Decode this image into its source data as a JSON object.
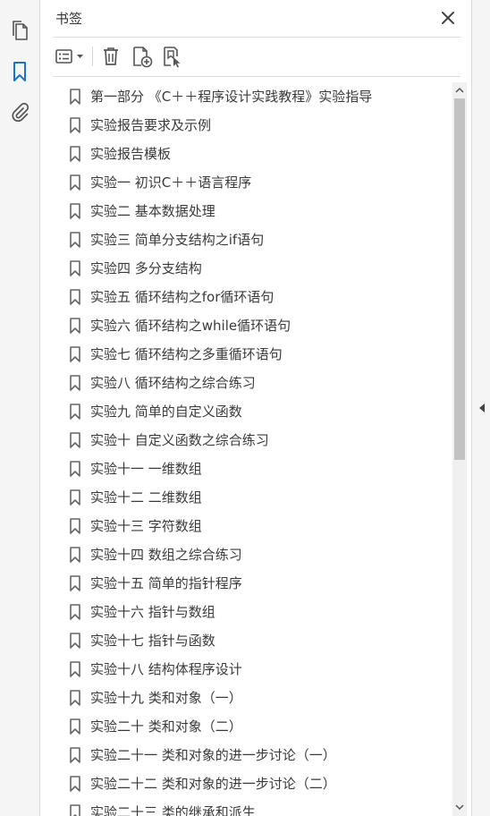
{
  "panel": {
    "title": "书签"
  },
  "rail": {
    "items": [
      {
        "icon": "pages-icon"
      },
      {
        "icon": "bookmark-icon",
        "active": true
      },
      {
        "icon": "paperclip-icon"
      }
    ]
  },
  "toolbar": {
    "items": [
      {
        "icon": "options-menu-icon"
      },
      {
        "icon": "trash-icon"
      },
      {
        "icon": "new-bookmark-icon"
      },
      {
        "icon": "bookmark-from-selection-icon"
      }
    ]
  },
  "colors": {
    "accent": "#1a73c9",
    "icon": "#555555",
    "text": "#3a3a3a",
    "scroll_thumb": "#c2c2c2"
  },
  "bookmarks": [
    {
      "label": "第一部分 《C＋＋程序设计实践教程》实验指导"
    },
    {
      "label": "实验报告要求及示例"
    },
    {
      "label": "实验报告模板"
    },
    {
      "label": "实验一  初识C＋＋语言程序"
    },
    {
      "label": "实验二  基本数据处理"
    },
    {
      "label": "实验三  简单分支结构之if语句"
    },
    {
      "label": "实验四  多分支结构"
    },
    {
      "label": "实验五  循环结构之for循环语句"
    },
    {
      "label": "实验六  循环结构之while循环语句"
    },
    {
      "label": "实验七  循环结构之多重循环语句"
    },
    {
      "label": "实验八  循环结构之综合练习"
    },
    {
      "label": "实验九  简单的自定义函数"
    },
    {
      "label": "实验十  自定义函数之综合练习"
    },
    {
      "label": "实验十一  一维数组"
    },
    {
      "label": "实验十二  二维数组"
    },
    {
      "label": "实验十三  字符数组"
    },
    {
      "label": "实验十四  数组之综合练习"
    },
    {
      "label": "实验十五  简单的指针程序"
    },
    {
      "label": "实验十六  指针与数组"
    },
    {
      "label": "实验十七  指针与函数"
    },
    {
      "label": "实验十八  结构体程序设计"
    },
    {
      "label": "实验十九  类和对象（一）"
    },
    {
      "label": "实验二十  类和对象（二）"
    },
    {
      "label": "实验二十一  类和对象的进一步讨论（一）"
    },
    {
      "label": "实验二十二  类和对象的进一步讨论（二）"
    },
    {
      "label": "实验二十三  类的继承和派生"
    }
  ]
}
